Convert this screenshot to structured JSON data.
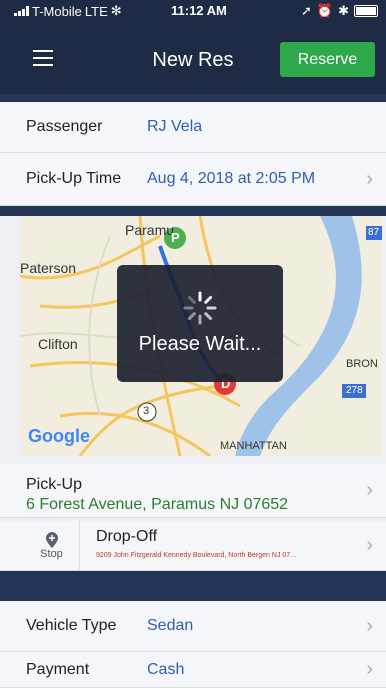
{
  "status_bar": {
    "carrier": "T-Mobile",
    "network": "LTE",
    "time": "11:12 AM"
  },
  "nav": {
    "title": "New Res",
    "reserve_label": "Reserve"
  },
  "fields": {
    "passenger_label": "Passenger",
    "passenger_value": "RJ Vela",
    "pickup_time_label": "Pick-Up Time",
    "pickup_time_value": "Aug 4, 2018 at 2:05 PM",
    "pickup_label": "Pick-Up",
    "pickup_value": "6 Forest Avenue, Paramus NJ 07652",
    "stop_label": "Stop",
    "dropoff_label": "Drop-Off",
    "dropoff_value": "9209 John Fitzgerald Kennedy Boulevard, North Bergen NJ 07...",
    "vehicle_type_label": "Vehicle Type",
    "vehicle_type_value": "Sedan",
    "payment_label": "Payment",
    "payment_value": "Cash"
  },
  "map": {
    "labels": {
      "paramus": "Paramu",
      "paterson": "Paterson",
      "clifton": "Clifton",
      "bronx": "BRON",
      "manhattan": "MANHATTAN",
      "route_3": "3",
      "route_278": "278",
      "route_87": "87"
    },
    "pin_p": "P",
    "pin_d": "D",
    "google": "Google"
  },
  "overlay": {
    "text": "Please Wait..."
  },
  "colors": {
    "navbar": "#1f2a44",
    "reserve": "#2ea84a",
    "link": "#2f5fb0",
    "pickup_address": "#2d7d2d",
    "dropoff_address": "#c0392b"
  }
}
